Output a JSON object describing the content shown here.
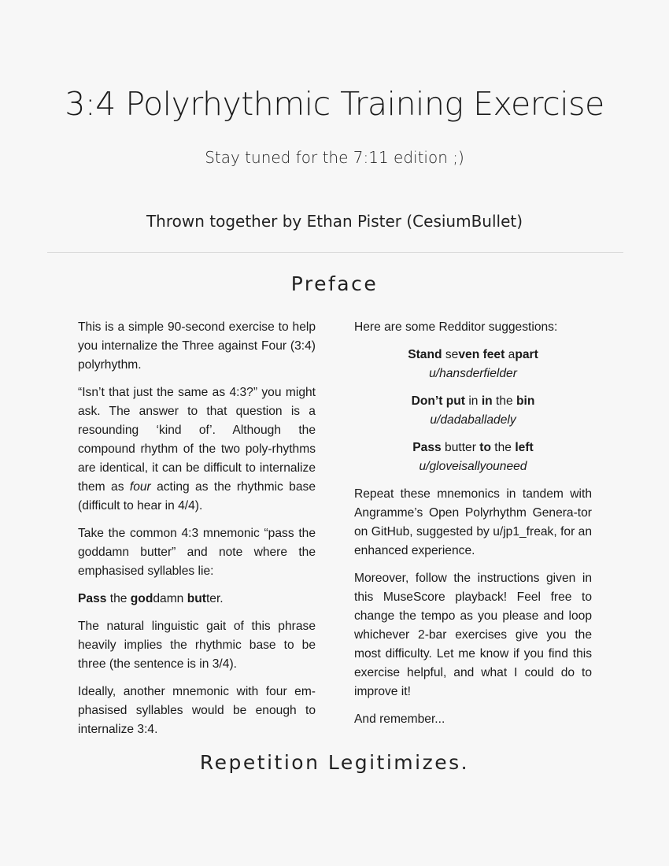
{
  "title": "3:4 Polyrhythmic Training Exercise",
  "subtitle": "Stay tuned for the 7:11 edition ;)",
  "author": "Thrown together by Ethan Pister (CesiumBullet)",
  "preface": {
    "heading": "Preface",
    "left": {
      "p1": "This is a simple 90-second exercise to help you internalize the Three against Four (3:4) polyrhythm.",
      "p2_a": "“Isn’t that just the same as 4:3?” you might ask. The answer to that question is a resounding ‘kind of’. Although the compound rhythm of the two poly-rhythms are identical, it can be difficult to internalize them as ",
      "p2_em": "four",
      "p2_b": " acting as the rhythmic base (difficult to hear in 4/4).",
      "p3": "Take the common 4:3 mnemonic “pass the goddamn butter” and note where the emphasised syllables lie:",
      "p4": {
        "s1": "Pass",
        "s2": " the ",
        "s3": "god",
        "s4": "damn ",
        "s5": "but",
        "s6": "ter."
      },
      "p5": "The natural linguistic gait of this phrase heavily implies the rhythmic base to be three (the sentence is in 3/4).",
      "p6": "Ideally, another mnemonic with four em-phasised syllables would be enough to internalize 3:4."
    },
    "right": {
      "intro": "Here are some Redditor suggestions:",
      "suggestions": [
        {
          "parts": [
            {
              "text": "Stand",
              "bold": true
            },
            {
              "text": " se",
              "bold": false
            },
            {
              "text": "ven",
              "bold": true
            },
            {
              "text": " ",
              "bold": false
            },
            {
              "text": "feet",
              "bold": true
            },
            {
              "text": " a",
              "bold": false
            },
            {
              "text": "part",
              "bold": true
            }
          ],
          "user": "u/hansderfielder"
        },
        {
          "parts": [
            {
              "text": "Don’t put",
              "bold": true
            },
            {
              "text": " in ",
              "bold": false
            },
            {
              "text": "in",
              "bold": true
            },
            {
              "text": " the ",
              "bold": false
            },
            {
              "text": "bin",
              "bold": true
            }
          ],
          "user": "u/dadaballadely"
        },
        {
          "parts": [
            {
              "text": "Pass",
              "bold": true
            },
            {
              "text": " butter ",
              "bold": false
            },
            {
              "text": "to",
              "bold": true
            },
            {
              "text": " the ",
              "bold": false
            },
            {
              "text": "left",
              "bold": true
            }
          ],
          "user": "u/gloveisallyouneed"
        }
      ],
      "p1": "Repeat these mnemonics in tandem with Angramme’s Open Polyrhythm Genera-tor on GitHub, suggested by u/jp1_freak, for an enhanced experience.",
      "p2": "Moreover, follow the instructions given in this MuseScore playback! Feel free to change the tempo as you please and loop whichever 2-bar exercises give you the most difficulty. Let me know if you find this exercise helpful, and what I could do to improve it!",
      "p3": "And remember..."
    }
  },
  "closing": "Repetition Legitimizes."
}
